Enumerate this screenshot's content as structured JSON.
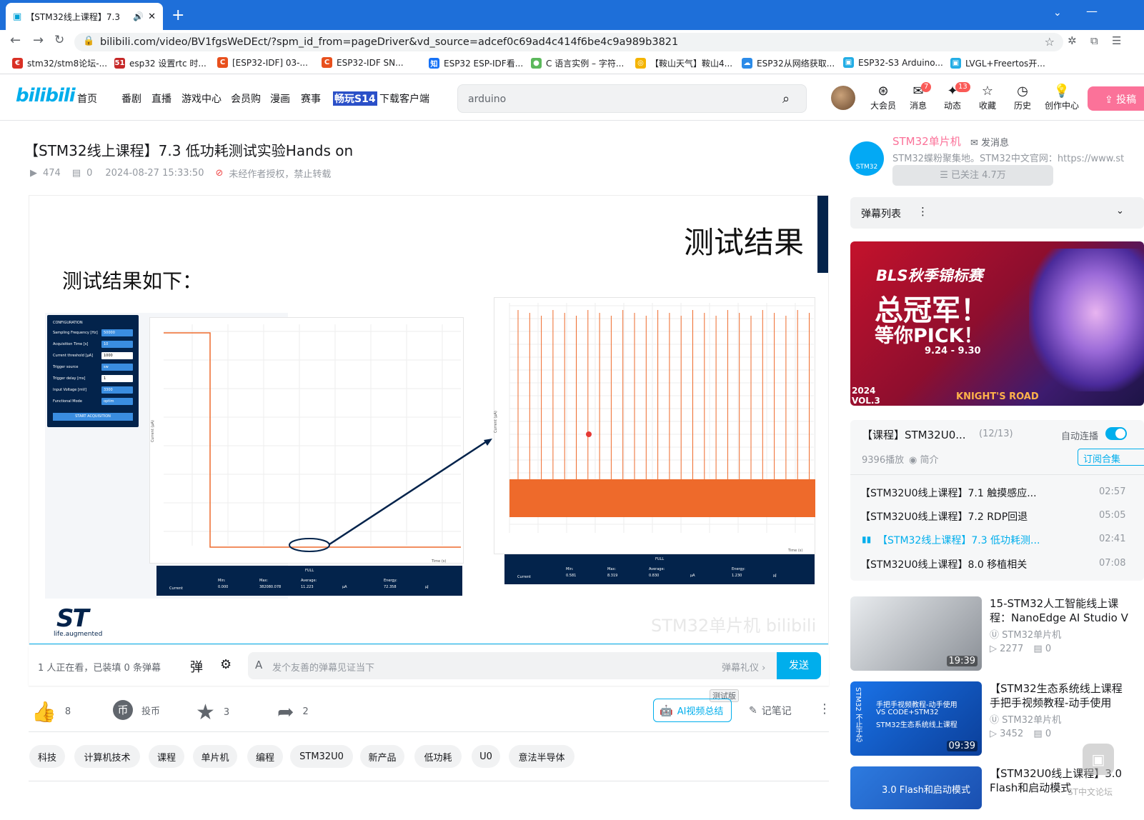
{
  "browser": {
    "tab_title": "【STM32线上课程】7.3",
    "url": "bilibili.com/video/BV1fgsWeDEct/?spm_id_from=pageDriver&vd_source=adcef0c69ad4c414f6be4c9a989b3821",
    "bookmarks": [
      {
        "label": "stm32/stm8论坛-...",
        "color": "#d93025",
        "glyph": "€"
      },
      {
        "label": "esp32 设置rtc 时...",
        "color": "#c62828",
        "glyph": "51"
      },
      {
        "label": "[ESP32-IDF] 03-...",
        "color": "#e8501d",
        "glyph": "C"
      },
      {
        "label": "ESP32-IDF SN...",
        "color": "#e8501d",
        "glyph": "C"
      },
      {
        "label": "ESP32 ESP-IDF看...",
        "color": "#1772f6",
        "glyph": "知"
      },
      {
        "label": "C 语言实例 – 字符...",
        "color": "#5cb85c",
        "glyph": "●"
      },
      {
        "label": "【鞍山天气】鞍山4...",
        "color": "#f4b400",
        "glyph": "◎"
      },
      {
        "label": "ESP32从网络获取...",
        "color": "#2b8be8",
        "glyph": "☁"
      },
      {
        "label": "ESP32-S3 Arduino...",
        "color": "#23ade5",
        "glyph": "▣"
      },
      {
        "label": "LVGL+Freertos开...",
        "color": "#23ade5",
        "glyph": "▣"
      }
    ]
  },
  "header": {
    "logo": "bilibili",
    "nav": [
      "首页",
      "番剧",
      "直播",
      "游戏中心",
      "会员购",
      "漫画",
      "赛事",
      "畅玩S14",
      "下载客户端"
    ],
    "search_value": "arduino",
    "icons": [
      {
        "label": "大会员",
        "badge": ""
      },
      {
        "label": "消息",
        "badge": "7"
      },
      {
        "label": "动态",
        "badge": "13"
      },
      {
        "label": "收藏",
        "badge": ""
      },
      {
        "label": "历史",
        "badge": ""
      },
      {
        "label": "创作中心",
        "badge": ""
      }
    ]
  },
  "video": {
    "title": "【STM32线上课程】7.3 低功耗测试实验Hands on",
    "views": "474",
    "danmaku_count": "0",
    "date": "2024-08-27 15:33:50",
    "copyright": "未经作者授权，禁止转载",
    "slide": {
      "title": "测试结果",
      "subtitle": "测试结果如下：",
      "logo_text": "life.augmented",
      "watermark": "STM32单片机 bilibili",
      "config": {
        "header": "CONFIGURATION",
        "rows": [
          {
            "label": "Sampling Frequency [Hz]",
            "value": "50000"
          },
          {
            "label": "Acquisition Time [s]",
            "value": "10"
          },
          {
            "label": "Current threshold [µA]",
            "value": "1000"
          },
          {
            "label": "Trigger source",
            "value": "sw"
          },
          {
            "label": "Trigger delay [ms]",
            "value": "1"
          },
          {
            "label": "Input Voltage [mV]",
            "value": "3300"
          },
          {
            "label": "Functional Mode",
            "value": "optim"
          }
        ],
        "button": "START ACQUISITION"
      },
      "left_table": {
        "title": "FULL",
        "row_label": "Current",
        "headers": [
          "Min:",
          "Max:",
          "Average:",
          "",
          "Energy:",
          ""
        ],
        "values": [
          "0.000",
          "382080.078",
          "11.223",
          "µA",
          "72.358",
          "µJ"
        ]
      },
      "right_table": {
        "title": "FULL",
        "row_label": "Current",
        "headers": [
          "Min:",
          "Max:",
          "Average:",
          "",
          "Energy:",
          ""
        ],
        "values": [
          "0.581",
          "8.319",
          "0.830",
          "µA",
          "1.230",
          "µJ"
        ]
      },
      "y_label": "Current (µA)",
      "x_label": "Time (s)"
    }
  },
  "danmaku_bar": {
    "watching": "1 人正在看，已装填 0 条弹幕",
    "placeholder": "发个友善的弹幕见证当下",
    "etiquette": "弹幕礼仪 ›",
    "send": "发送"
  },
  "actions": {
    "like": "8",
    "coin": "投币",
    "fav": "3",
    "share": "2",
    "ai_summary": "AI视频总结",
    "beta": "测试版",
    "notes": "记笔记"
  },
  "tags": [
    "科技",
    "计算机技术",
    "课程",
    "单片机",
    "编程",
    "STM32U0",
    "新产品",
    "低功耗",
    "U0",
    "意法半导体"
  ],
  "uploader": {
    "name": "STM32单片机",
    "avatar_text": "STM32",
    "message": "发消息",
    "desc": "STM32蝶粉聚集地。STM32中文官网：https://www.st",
    "follow": "已关注 4.7万"
  },
  "danmaku_list": {
    "title": "弹幕列表"
  },
  "ad": {
    "headline1": "BLS秋季锦标赛",
    "headline2": "总冠军！",
    "headline3": "等你PICK！",
    "dates": "9.24 - 9.30",
    "year": "2024 VOL.3",
    "road": "KNIGHT'S ROAD"
  },
  "playlist": {
    "title": "【课程】STM32U0...",
    "progress": "(12/13)",
    "autoplay": "自动连播",
    "plays": "9396播放",
    "intro": "简介",
    "subscribe": "订阅合集",
    "items": [
      {
        "title": "【STM32U0线上课程】7.1 触摸感应...",
        "time": "02:57",
        "active": false
      },
      {
        "title": "【STM32U0线上课程】7.2 RDP回退",
        "time": "05:05",
        "active": false
      },
      {
        "title": "【STM32线上课程】7.3 低功耗测...",
        "time": "02:41",
        "active": true
      },
      {
        "title": "【STM32U0线上课程】8.0 移植相关",
        "time": "07:08",
        "active": false
      }
    ]
  },
  "recommendations": [
    {
      "title1": "15-STM32人工智能线上课",
      "title2": "程：NanoEdge AI Studio V",
      "up": "STM32单片机",
      "views": "2277",
      "dm": "0",
      "dur": "19:39"
    },
    {
      "title1": "【STM32生态系统线上课程",
      "title2": "手把手视频教程-动手使用",
      "up": "STM32单片机",
      "views": "3452",
      "dm": "0",
      "dur": "09:39",
      "thumb_lines": [
        "手把手视频教程-动手使用",
        "VS CODE+STM32",
        "STM32生态系统线上课程"
      ],
      "thumb_side": "STM32 不止于芯"
    },
    {
      "title1": "【STM32U0线上课程】3.0",
      "title2": "Flash和启动模式",
      "up": "",
      "views": "",
      "dm": "",
      "dur": "",
      "thumb_lines": [
        "3.0 Flash和启动模式"
      ],
      "watermark": "ST中文论坛"
    }
  ]
}
